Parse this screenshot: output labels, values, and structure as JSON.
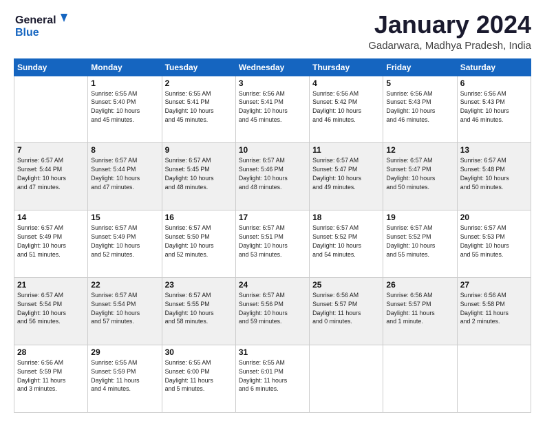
{
  "header": {
    "logo_line1": "General",
    "logo_line2": "Blue",
    "month_year": "January 2024",
    "location": "Gadarwara, Madhya Pradesh, India"
  },
  "weekdays": [
    "Sunday",
    "Monday",
    "Tuesday",
    "Wednesday",
    "Thursday",
    "Friday",
    "Saturday"
  ],
  "rows": [
    [
      {
        "date": "",
        "info": ""
      },
      {
        "date": "1",
        "info": "Sunrise: 6:55 AM\nSunset: 5:40 PM\nDaylight: 10 hours\nand 45 minutes."
      },
      {
        "date": "2",
        "info": "Sunrise: 6:55 AM\nSunset: 5:41 PM\nDaylight: 10 hours\nand 45 minutes."
      },
      {
        "date": "3",
        "info": "Sunrise: 6:56 AM\nSunset: 5:41 PM\nDaylight: 10 hours\nand 45 minutes."
      },
      {
        "date": "4",
        "info": "Sunrise: 6:56 AM\nSunset: 5:42 PM\nDaylight: 10 hours\nand 46 minutes."
      },
      {
        "date": "5",
        "info": "Sunrise: 6:56 AM\nSunset: 5:43 PM\nDaylight: 10 hours\nand 46 minutes."
      },
      {
        "date": "6",
        "info": "Sunrise: 6:56 AM\nSunset: 5:43 PM\nDaylight: 10 hours\nand 46 minutes."
      }
    ],
    [
      {
        "date": "7",
        "info": "Sunrise: 6:57 AM\nSunset: 5:44 PM\nDaylight: 10 hours\nand 47 minutes."
      },
      {
        "date": "8",
        "info": "Sunrise: 6:57 AM\nSunset: 5:44 PM\nDaylight: 10 hours\nand 47 minutes."
      },
      {
        "date": "9",
        "info": "Sunrise: 6:57 AM\nSunset: 5:45 PM\nDaylight: 10 hours\nand 48 minutes."
      },
      {
        "date": "10",
        "info": "Sunrise: 6:57 AM\nSunset: 5:46 PM\nDaylight: 10 hours\nand 48 minutes."
      },
      {
        "date": "11",
        "info": "Sunrise: 6:57 AM\nSunset: 5:47 PM\nDaylight: 10 hours\nand 49 minutes."
      },
      {
        "date": "12",
        "info": "Sunrise: 6:57 AM\nSunset: 5:47 PM\nDaylight: 10 hours\nand 50 minutes."
      },
      {
        "date": "13",
        "info": "Sunrise: 6:57 AM\nSunset: 5:48 PM\nDaylight: 10 hours\nand 50 minutes."
      }
    ],
    [
      {
        "date": "14",
        "info": "Sunrise: 6:57 AM\nSunset: 5:49 PM\nDaylight: 10 hours\nand 51 minutes."
      },
      {
        "date": "15",
        "info": "Sunrise: 6:57 AM\nSunset: 5:49 PM\nDaylight: 10 hours\nand 52 minutes."
      },
      {
        "date": "16",
        "info": "Sunrise: 6:57 AM\nSunset: 5:50 PM\nDaylight: 10 hours\nand 52 minutes."
      },
      {
        "date": "17",
        "info": "Sunrise: 6:57 AM\nSunset: 5:51 PM\nDaylight: 10 hours\nand 53 minutes."
      },
      {
        "date": "18",
        "info": "Sunrise: 6:57 AM\nSunset: 5:52 PM\nDaylight: 10 hours\nand 54 minutes."
      },
      {
        "date": "19",
        "info": "Sunrise: 6:57 AM\nSunset: 5:52 PM\nDaylight: 10 hours\nand 55 minutes."
      },
      {
        "date": "20",
        "info": "Sunrise: 6:57 AM\nSunset: 5:53 PM\nDaylight: 10 hours\nand 55 minutes."
      }
    ],
    [
      {
        "date": "21",
        "info": "Sunrise: 6:57 AM\nSunset: 5:54 PM\nDaylight: 10 hours\nand 56 minutes."
      },
      {
        "date": "22",
        "info": "Sunrise: 6:57 AM\nSunset: 5:54 PM\nDaylight: 10 hours\nand 57 minutes."
      },
      {
        "date": "23",
        "info": "Sunrise: 6:57 AM\nSunset: 5:55 PM\nDaylight: 10 hours\nand 58 minutes."
      },
      {
        "date": "24",
        "info": "Sunrise: 6:57 AM\nSunset: 5:56 PM\nDaylight: 10 hours\nand 59 minutes."
      },
      {
        "date": "25",
        "info": "Sunrise: 6:56 AM\nSunset: 5:57 PM\nDaylight: 11 hours\nand 0 minutes."
      },
      {
        "date": "26",
        "info": "Sunrise: 6:56 AM\nSunset: 5:57 PM\nDaylight: 11 hours\nand 1 minute."
      },
      {
        "date": "27",
        "info": "Sunrise: 6:56 AM\nSunset: 5:58 PM\nDaylight: 11 hours\nand 2 minutes."
      }
    ],
    [
      {
        "date": "28",
        "info": "Sunrise: 6:56 AM\nSunset: 5:59 PM\nDaylight: 11 hours\nand 3 minutes."
      },
      {
        "date": "29",
        "info": "Sunrise: 6:55 AM\nSunset: 5:59 PM\nDaylight: 11 hours\nand 4 minutes."
      },
      {
        "date": "30",
        "info": "Sunrise: 6:55 AM\nSunset: 6:00 PM\nDaylight: 11 hours\nand 5 minutes."
      },
      {
        "date": "31",
        "info": "Sunrise: 6:55 AM\nSunset: 6:01 PM\nDaylight: 11 hours\nand 6 minutes."
      },
      {
        "date": "",
        "info": ""
      },
      {
        "date": "",
        "info": ""
      },
      {
        "date": "",
        "info": ""
      }
    ]
  ]
}
